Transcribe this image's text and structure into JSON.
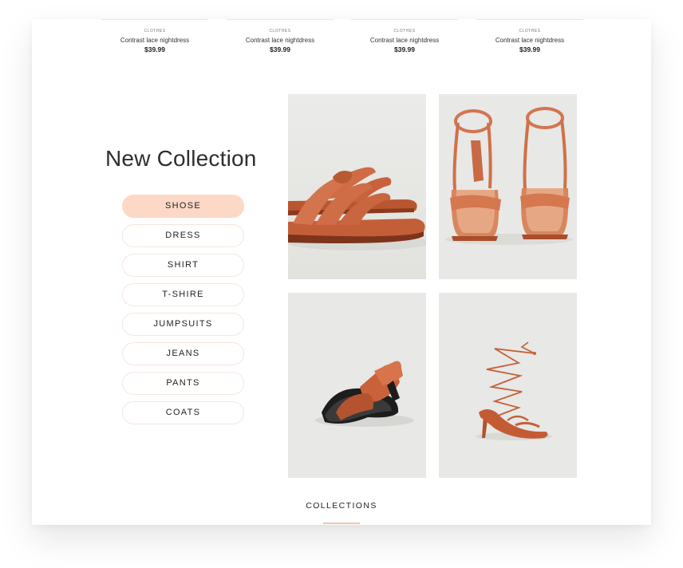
{
  "products": [
    {
      "category": "CLOTHES",
      "name": "Contrast lace nightdress",
      "price": "$39.99"
    },
    {
      "category": "CLOTHES",
      "name": "Contrast lace nightdress",
      "price": "$39.99"
    },
    {
      "category": "CLOTHES",
      "name": "Contrast lace nightdress",
      "price": "$39.99"
    },
    {
      "category": "CLOTHES",
      "name": "Contrast lace nightdress",
      "price": "$39.99"
    }
  ],
  "collection": {
    "title": "New Collection",
    "categories": [
      {
        "label": "SHOSE",
        "active": true
      },
      {
        "label": "DRESS",
        "active": false
      },
      {
        "label": "SHIRT",
        "active": false
      },
      {
        "label": "T-SHIRE",
        "active": false
      },
      {
        "label": "JUMPSUITS",
        "active": false
      },
      {
        "label": "JEANS",
        "active": false
      },
      {
        "label": "PANTS",
        "active": false
      },
      {
        "label": "COATS",
        "active": false
      }
    ],
    "images": [
      {
        "subject": "strappy-flat-sandals-image"
      },
      {
        "subject": "ankle-strap-heeled-sandals-image"
      },
      {
        "subject": "square-toe-mules-image"
      },
      {
        "subject": "lace-up-heeled-sandal-image"
      }
    ]
  },
  "footer": {
    "collections_label": "COLLECTIONS"
  },
  "colors": {
    "accent": "#fdd8c6",
    "accent_line": "#f4c4ab",
    "shoe_terracotta": "#d2714e",
    "image_background": "#e9e9e7"
  }
}
